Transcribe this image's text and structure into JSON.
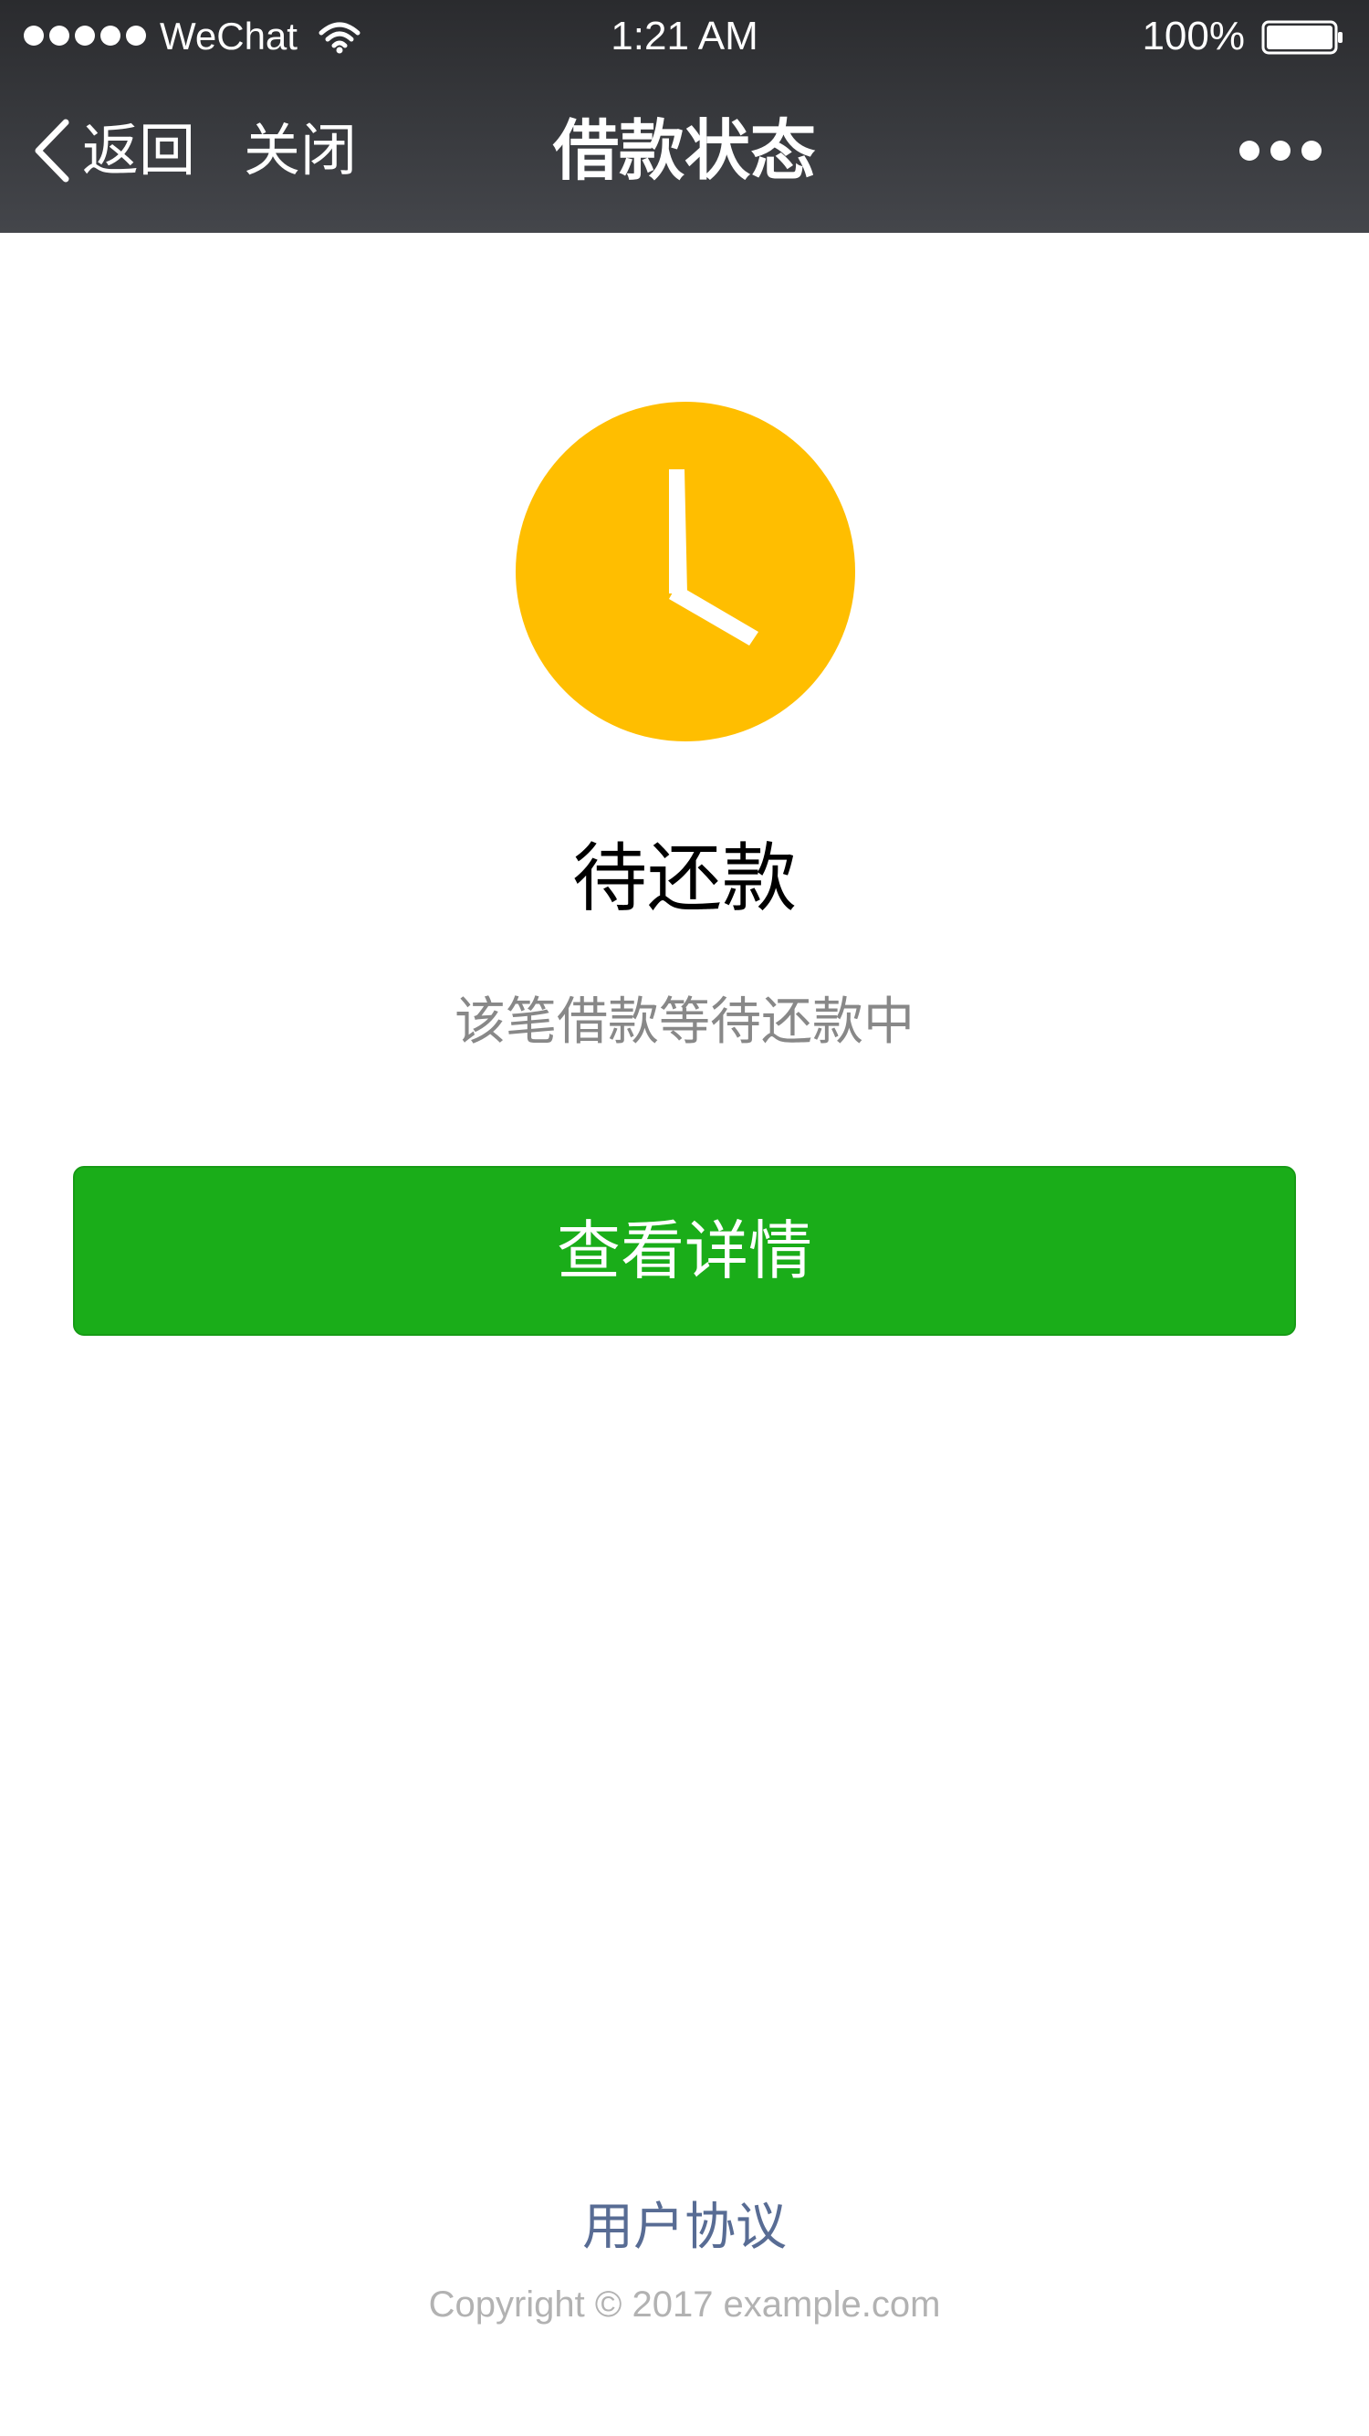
{
  "status_bar": {
    "carrier": "WeChat",
    "time": "1:21 AM",
    "battery": "100%",
    "signal_icon": "signal-dots-icon",
    "wifi_icon": "wifi-icon",
    "battery_icon": "battery-full-icon"
  },
  "nav": {
    "back_label": "返回",
    "close_label": "关闭",
    "title": "借款状态",
    "more_icon": "more-dots-icon"
  },
  "main": {
    "status_icon": "clock-icon",
    "status_title": "待还款",
    "status_desc": "该笔借款等待还款中",
    "detail_button_label": "查看详情"
  },
  "footer": {
    "agreement_link": "用户协议",
    "copyright": "Copyright © 2017 example.com"
  },
  "colors": {
    "navbar_bg": "#393a3f",
    "accent_green": "#1aad19",
    "clock_yellow": "#ffbe00",
    "link_blue": "#586c94",
    "desc_gray": "#888888"
  }
}
